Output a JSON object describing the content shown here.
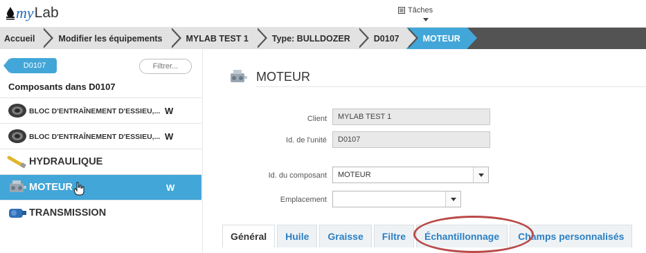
{
  "header": {
    "logo_prefix": "my",
    "logo_suffix": "Lab",
    "tasks_label": "Tâches"
  },
  "breadcrumb": [
    {
      "label": "Accueil",
      "active": false
    },
    {
      "label": "Modifier les équipements",
      "active": false
    },
    {
      "label": "MYLAB TEST 1",
      "active": false
    },
    {
      "label": "Type: BULLDOZER",
      "active": false
    },
    {
      "label": "D0107",
      "active": false
    },
    {
      "label": "MOTEUR",
      "active": true
    }
  ],
  "left": {
    "parent_tag": "D0107",
    "filter_placeholder": "Filtrer...",
    "components_title": "Composants dans D0107",
    "components": [
      {
        "label": "BLOC D'ENTRAÎNEMENT D'ESSIEU,...",
        "flag": "W",
        "icon": "axle-drive-icon",
        "selected": false
      },
      {
        "label": "BLOC D'ENTRAÎNEMENT D'ESSIEU,...",
        "flag": "W",
        "icon": "axle-drive-icon",
        "selected": false
      },
      {
        "label": "HYDRAULIQUE",
        "flag": "",
        "icon": "hydraulic-hose-icon",
        "selected": false
      },
      {
        "label": "MOTEUR",
        "flag": "W",
        "icon": "engine-icon",
        "selected": true
      },
      {
        "label": "TRANSMISSION",
        "flag": "",
        "icon": "transmission-icon",
        "selected": false
      }
    ]
  },
  "main": {
    "title": "MOTEUR",
    "form": {
      "client_label": "Client",
      "client_value": "MYLAB TEST 1",
      "unit_label": "Id. de l'unité",
      "unit_value": "D0107",
      "component_label": "Id. du composant",
      "component_value": "MOTEUR",
      "location_label": "Emplacement",
      "location_value": ""
    },
    "tabs": [
      {
        "label": "Général",
        "active": true
      },
      {
        "label": "Huile",
        "active": false
      },
      {
        "label": "Graisse",
        "active": false
      },
      {
        "label": "Filtre",
        "active": false
      },
      {
        "label": "Échantillonnage",
        "active": false
      },
      {
        "label": "Champs personnalisés",
        "active": false
      }
    ]
  },
  "colors": {
    "accent": "#42a6d8",
    "breadcrumb_bg": "#535353",
    "crumb_bg": "#e2e2e2",
    "link": "#2b7fc3",
    "highlight": "#b94a48"
  }
}
